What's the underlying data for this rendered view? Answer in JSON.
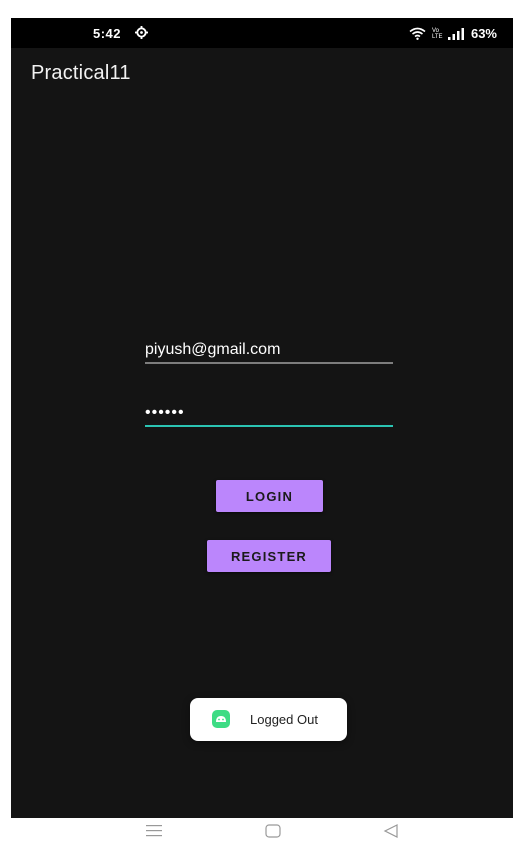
{
  "status_bar": {
    "time": "5:42",
    "network_label": "Vo LTE",
    "battery": "63%"
  },
  "app": {
    "title": "Practical11"
  },
  "form": {
    "email_value": "piyush@gmail.com",
    "password_value": "••••••",
    "login_label": "LOGIN",
    "register_label": "REGISTER"
  },
  "toast": {
    "message": "Logged Out"
  },
  "colors": {
    "background": "#141414",
    "accent_button": "#bb86fc",
    "focused_underline": "#2bc4b3",
    "toast_icon": "#3ddc84"
  },
  "icons": {
    "status_gear": "settings-icon",
    "wifi": "wifi-icon",
    "signal": "signal-icon",
    "toast": "android-icon",
    "nav_menu": "menu-icon",
    "nav_home": "home-icon",
    "nav_back": "back-icon"
  }
}
